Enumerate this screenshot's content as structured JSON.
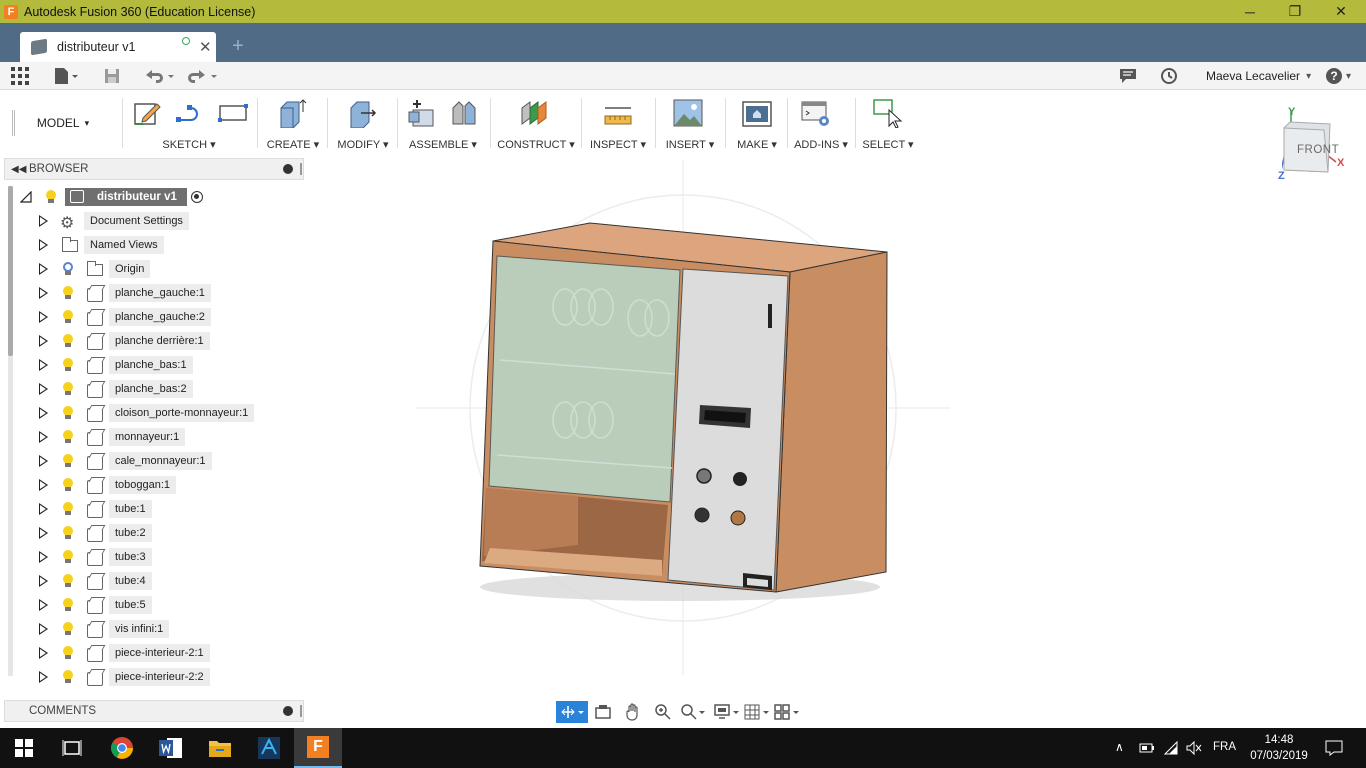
{
  "window": {
    "title": "Autodesk Fusion 360 (Education License)",
    "app_icon_letter": "F",
    "minimize": "─",
    "maximize": "❐",
    "close": "✕",
    "accent": "#b4bb3c"
  },
  "tabs": {
    "active_tab": "distributeur v1",
    "close": "✕",
    "new_tab": "+"
  },
  "quickbar": {
    "user": "Maeva Lecavelier",
    "dropdown": "▾",
    "help": "?"
  },
  "ribbon": {
    "workspace": "MODEL",
    "groups": [
      {
        "label": "SKETCH ▾"
      },
      {
        "label": "CREATE ▾"
      },
      {
        "label": "MODIFY ▾"
      },
      {
        "label": "ASSEMBLE ▾"
      },
      {
        "label": "CONSTRUCT ▾"
      },
      {
        "label": "INSPECT ▾"
      },
      {
        "label": "INSERT ▾"
      },
      {
        "label": "MAKE ▾"
      },
      {
        "label": "ADD-INS ▾"
      },
      {
        "label": "SELECT ▾"
      }
    ]
  },
  "browser": {
    "title": "BROWSER",
    "root": "distributeur v1",
    "items": [
      {
        "label": "Document Settings",
        "icon": "gear-icon"
      },
      {
        "label": "Named Views",
        "icon": "folder-icon"
      },
      {
        "label": "Origin",
        "icon": "folder-icon"
      },
      {
        "label": "planche_gauche:1",
        "icon": "component-icon"
      },
      {
        "label": "planche_gauche:2",
        "icon": "component-icon"
      },
      {
        "label": "planche derrière:1",
        "icon": "component-icon"
      },
      {
        "label": "planche_bas:1",
        "icon": "component-icon"
      },
      {
        "label": "planche_bas:2",
        "icon": "component-icon"
      },
      {
        "label": "cloison_porte-monnayeur:1",
        "icon": "component-icon"
      },
      {
        "label": "monnayeur:1",
        "icon": "component-icon"
      },
      {
        "label": "cale_monnayeur:1",
        "icon": "component-icon"
      },
      {
        "label": "toboggan:1",
        "icon": "component-icon"
      },
      {
        "label": "tube:1",
        "icon": "component-icon"
      },
      {
        "label": "tube:2",
        "icon": "component-icon"
      },
      {
        "label": "tube:3",
        "icon": "component-icon"
      },
      {
        "label": "tube:4",
        "icon": "component-icon"
      },
      {
        "label": "tube:5",
        "icon": "component-icon"
      },
      {
        "label": "vis infini:1",
        "icon": "component-icon"
      },
      {
        "label": "piece-interieur-2:1",
        "icon": "component-icon"
      },
      {
        "label": "piece-interieur-2:2",
        "icon": "component-icon"
      }
    ]
  },
  "comments": {
    "title": "COMMENTS"
  },
  "viewcube": {
    "face": "FRONT",
    "axis_x": "X",
    "axis_y": "Y",
    "axis_z": "Z"
  },
  "taskbar": {
    "language": "FRA",
    "time": "14:48",
    "date": "07/03/2019"
  },
  "colors": {
    "tab_bar": "#4f6b86",
    "wood": "#c98d62",
    "panel": "#dcdcdc",
    "glass": "#b9d3c3"
  }
}
